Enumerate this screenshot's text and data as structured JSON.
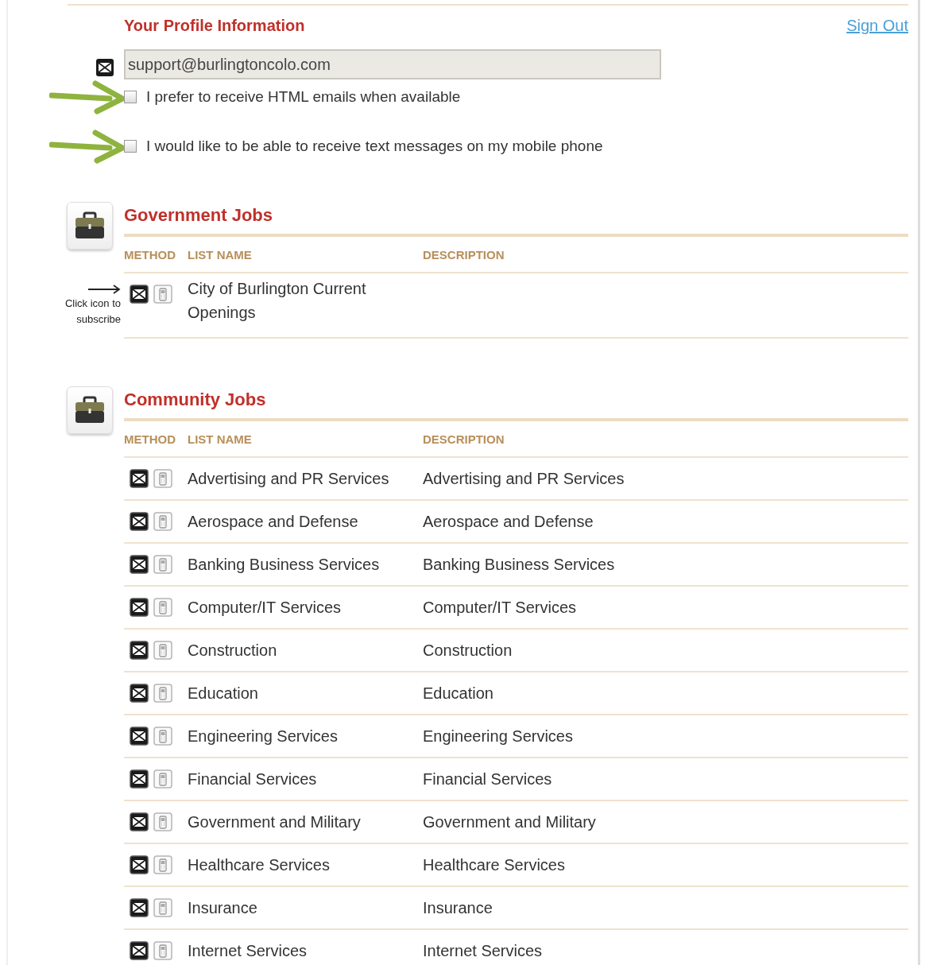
{
  "profile": {
    "title": "Your Profile Information",
    "sign_out": "Sign Out",
    "email": "support@burlingtoncolo.com",
    "options": [
      {
        "label": "I prefer to receive HTML emails when available",
        "checked": false,
        "pointer": true
      },
      {
        "label": "I would like to be able to receive text messages on my mobile phone",
        "checked": false,
        "pointer": true
      }
    ]
  },
  "sections": [
    {
      "title": "Government Jobs",
      "columns": [
        "METHOD",
        "LIST NAME",
        "DESCRIPTION"
      ],
      "note": "Click icon to subscribe",
      "rows": [
        {
          "name": "City of Burlington Current Openings",
          "email": true,
          "sms": false
        }
      ]
    },
    {
      "title": "Community Jobs",
      "columns": [
        "METHOD",
        "LIST NAME",
        "DESCRIPTION"
      ],
      "rows": [
        {
          "name": "Advertising and PR Services",
          "description": "Advertising and PR Services",
          "email": true,
          "sms": false
        },
        {
          "name": "Aerospace and Defense",
          "description": "Aerospace and Defense",
          "email": true,
          "sms": false
        },
        {
          "name": "Banking Business Services",
          "description": "Banking Business Services",
          "email": true,
          "sms": false
        },
        {
          "name": "Computer/IT Services",
          "description": "Computer/IT Services",
          "email": true,
          "sms": false
        },
        {
          "name": "Construction",
          "description": "Construction",
          "email": true,
          "sms": false
        },
        {
          "name": "Education",
          "description": "Education",
          "email": true,
          "sms": false
        },
        {
          "name": "Engineering Services",
          "description": "Engineering Services",
          "email": true,
          "sms": false
        },
        {
          "name": "Financial Services",
          "description": "Financial Services",
          "email": true,
          "sms": false
        },
        {
          "name": "Government and Military",
          "description": "Government and Military",
          "email": true,
          "sms": false
        },
        {
          "name": "Healthcare Services",
          "description": "Healthcare Services",
          "email": true,
          "sms": false
        },
        {
          "name": "Insurance",
          "description": "Insurance",
          "email": true,
          "sms": false
        },
        {
          "name": "Internet Services",
          "description": "Internet Services",
          "email": true,
          "sms": false
        }
      ]
    }
  ]
}
